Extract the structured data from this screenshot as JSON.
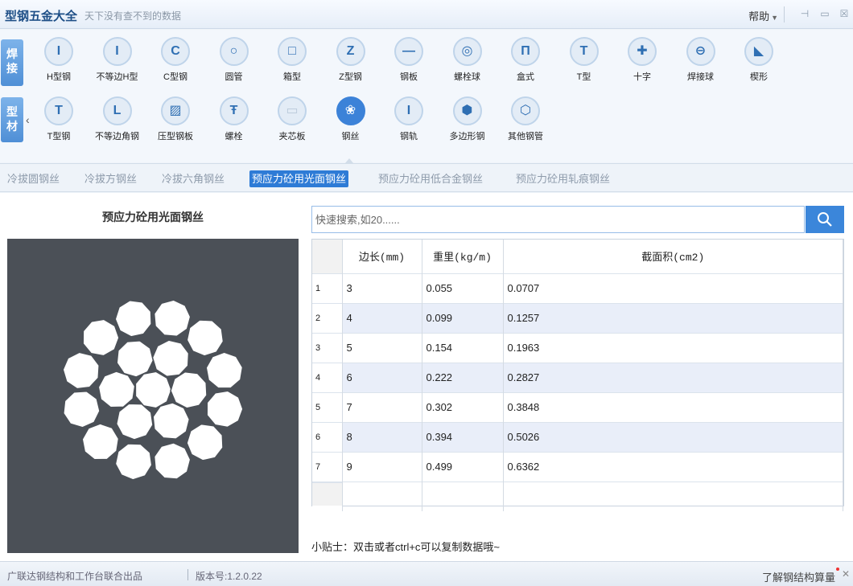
{
  "app": {
    "title": "型钢五金大全",
    "slogan": "天下没有查不到的数据",
    "help_label": "帮助",
    "help_caret": "▼",
    "pin_glyph": "⊣",
    "min_glyph": "▭",
    "close_glyph": "☒"
  },
  "categories": {
    "weld": "焊\n接",
    "profile": "型\n材",
    "nav_left": "‹"
  },
  "tools_row1": [
    {
      "label": "H型钢",
      "glyph": "I"
    },
    {
      "label": "不等边H型",
      "glyph": "I"
    },
    {
      "label": "C型钢",
      "glyph": "C"
    },
    {
      "label": "圆管",
      "glyph": "○"
    },
    {
      "label": "箱型",
      "glyph": "□"
    },
    {
      "label": "Z型钢",
      "glyph": "Z"
    },
    {
      "label": "钢板",
      "glyph": "—"
    },
    {
      "label": "螺栓球",
      "glyph": "◎"
    },
    {
      "label": "盒式",
      "glyph": "Π"
    },
    {
      "label": "T型",
      "glyph": "T"
    },
    {
      "label": "十字",
      "glyph": "✚"
    },
    {
      "label": "焊接球",
      "glyph": "⊖"
    },
    {
      "label": "楔形",
      "glyph": "◣"
    }
  ],
  "tools_row2": [
    {
      "label": "T型钢",
      "glyph": "T"
    },
    {
      "label": "不等边角钢",
      "glyph": "L"
    },
    {
      "label": "压型钢板",
      "glyph": "▨"
    },
    {
      "label": "螺栓",
      "glyph": "Ŧ"
    },
    {
      "label": "夹芯板",
      "glyph": "▭"
    },
    {
      "label": "钢丝",
      "glyph": "❀"
    },
    {
      "label": "钢轨",
      "glyph": "I"
    },
    {
      "label": "多边形钢",
      "glyph": "⬢"
    },
    {
      "label": "其他钢管",
      "glyph": "⬡"
    }
  ],
  "subtabs": [
    "冷拔圆钢丝",
    "冷拔方钢丝",
    "冷拔六角钢丝",
    "预应力砼用光面钢丝",
    "预应力砼用低合金钢丝",
    "预应力砼用轧痕钢丝"
  ],
  "active_subtab": 3,
  "preview": {
    "title": "预应力砼用光面钢丝"
  },
  "search": {
    "placeholder": "快速搜索,如20......"
  },
  "table": {
    "headers": [
      "边长(mm)",
      "重里(kg/m)",
      "截面积(cm2)"
    ],
    "rows": [
      {
        "num": "1",
        "side": "3",
        "weight": "0.055",
        "area": "0.0707"
      },
      {
        "num": "2",
        "side": "4",
        "weight": "0.099",
        "area": "0.1257"
      },
      {
        "num": "3",
        "side": "5",
        "weight": "0.154",
        "area": "0.1963"
      },
      {
        "num": "4",
        "side": "6",
        "weight": "0.222",
        "area": "0.2827"
      },
      {
        "num": "5",
        "side": "7",
        "weight": "0.302",
        "area": "0.3848"
      },
      {
        "num": "6",
        "side": "8",
        "weight": "0.394",
        "area": "0.5026"
      },
      {
        "num": "7",
        "side": "9",
        "weight": "0.499",
        "area": "0.6362"
      }
    ]
  },
  "tip": "小贴士：双击或者ctrl+c可以复制数据哦~",
  "status": {
    "credit": "广联达钢结构和工作台联合出品",
    "version": "版本号:1.2.0.22",
    "learn_link": "了解钢结构算量",
    "close_glyph": "✕"
  },
  "colors": {
    "accent": "#2e7bd6",
    "preview_bg": "#4b5057",
    "row_alt": "#e9eef9"
  }
}
